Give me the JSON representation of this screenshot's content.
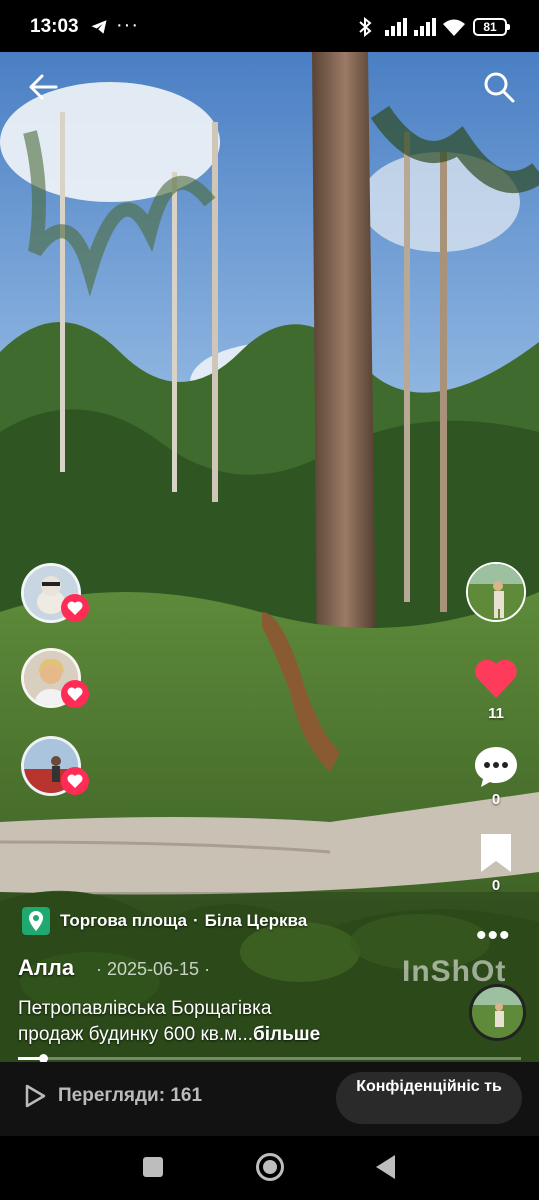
{
  "status_bar": {
    "time": "13:03",
    "battery": "81",
    "icons": [
      "telegram-icon",
      "more-dots",
      "bluetooth-icon",
      "signal-icon",
      "signal-icon",
      "wifi-icon",
      "battery-icon"
    ]
  },
  "overlay": {
    "location": {
      "place": "Торгова площа",
      "separator": "·",
      "city": "Біла Церква"
    },
    "author": "Алла",
    "date": "· 2025-06-15 ·",
    "watermark": "InShOt",
    "description_line1": "Петропавлівська Борщагівка",
    "description_line2": "продаж будинку 600 кв.м...",
    "more_link": "більше"
  },
  "right_rail": {
    "likes": "11",
    "comments": "0",
    "saves": "0",
    "like_color": "#ff3b5c"
  },
  "progress": {
    "fraction": 0.05
  },
  "bottom_bar": {
    "views_label": "Перегляди: 161",
    "privacy_button": "Конфіденційніс ть"
  }
}
